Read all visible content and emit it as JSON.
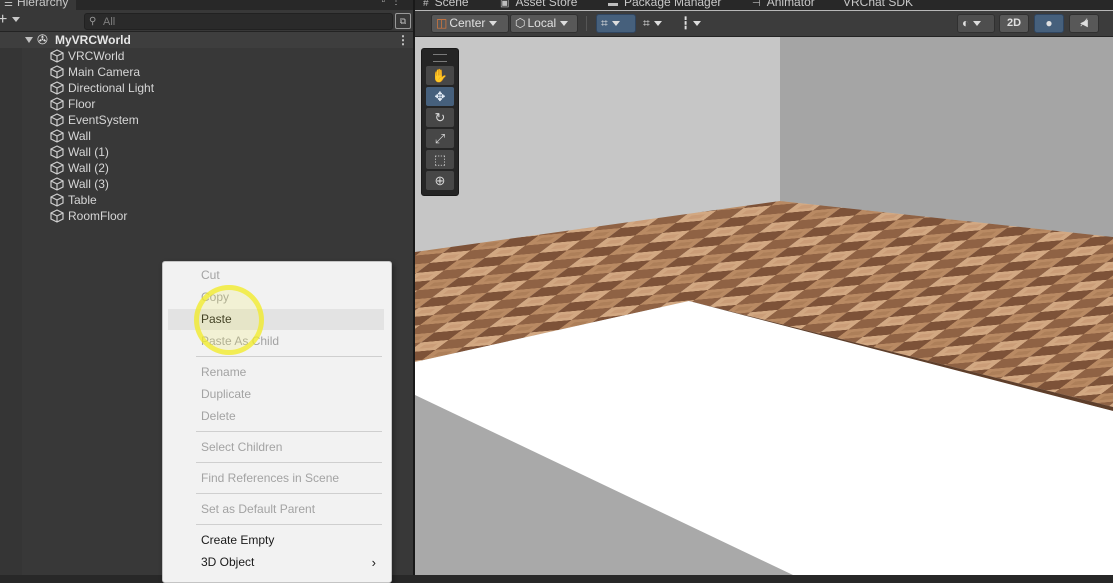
{
  "hierarchy": {
    "tab_title": "Hierarchy",
    "add_label": "+",
    "search_placeholder": "All",
    "scene_name": "MyVRCWorld",
    "items": [
      {
        "label": "VRCWorld"
      },
      {
        "label": "Main Camera"
      },
      {
        "label": "Directional Light"
      },
      {
        "label": "Floor"
      },
      {
        "label": "EventSystem"
      },
      {
        "label": "Wall"
      },
      {
        "label": "Wall (1)"
      },
      {
        "label": "Wall (2)"
      },
      {
        "label": "Wall (3)"
      },
      {
        "label": "Table"
      },
      {
        "label": "RoomFloor"
      }
    ]
  },
  "scene_tabs": [
    {
      "label": "Scene",
      "icon": "hash-icon"
    },
    {
      "label": "Asset Store",
      "icon": "store-icon"
    },
    {
      "label": "Package Manager",
      "icon": "package-icon"
    },
    {
      "label": "Animator",
      "icon": "animator-icon"
    },
    {
      "label": "VRChat SDK",
      "icon": ""
    }
  ],
  "scene_toolbar": {
    "pivot_label": "Center",
    "space_label": "Local",
    "mode_2d_label": "2D"
  },
  "context_menu": {
    "items": [
      {
        "label": "Cut",
        "enabled": false
      },
      {
        "label": "Copy",
        "enabled": false
      },
      {
        "label": "Paste",
        "enabled": true,
        "hovered": true
      },
      {
        "label": "Paste As Child",
        "enabled": false
      },
      {
        "label": "Rename",
        "enabled": false
      },
      {
        "label": "Duplicate",
        "enabled": false
      },
      {
        "label": "Delete",
        "enabled": false
      },
      {
        "label": "Select Children",
        "enabled": false
      },
      {
        "label": "Find References in Scene",
        "enabled": false
      },
      {
        "label": "Set as Default Parent",
        "enabled": false
      },
      {
        "label": "Create Empty",
        "enabled": true
      },
      {
        "label": "3D Object",
        "enabled": true,
        "submenu": true
      }
    ]
  },
  "colors": {
    "accent": "#46607c",
    "panel_bg": "#383838",
    "menu_bg": "#f2f2f2",
    "cursor_highlight": "#f0eb28"
  }
}
